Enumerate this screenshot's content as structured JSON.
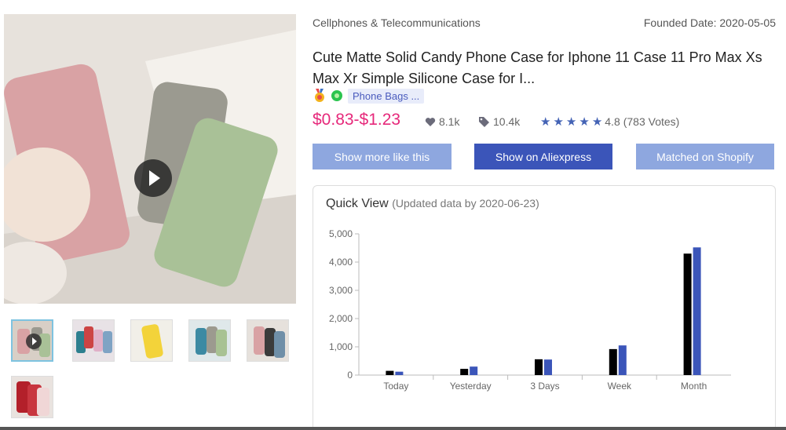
{
  "product": {
    "category": "Cellphones & Telecommunications",
    "founded": "Founded Date: 2020-05-05",
    "title": "Cute Matte Solid Candy Phone Case for Iphone 11 Case 11 Pro Max Xs Max Xr Simple Silicone Case for I...",
    "tag": "Phone Bags ...",
    "price": "$0.83-$1.23",
    "likes": "8.1k",
    "orders": "10.4k",
    "rating": "4.8",
    "votes": "(783 Votes)",
    "stars": 5
  },
  "buttons": {
    "more": "Show more like this",
    "aliexpress": "Show on Aliexpress",
    "shopify": "Matched on Shopify"
  },
  "quick_view": {
    "title": "Quick View",
    "subtitle": "(Updated data by 2020-06-23)"
  },
  "colors": {
    "price": "#e6287a",
    "accent": "#3b55b9",
    "accent_light": "#8ea7df",
    "series_a": "#000000",
    "series_b": "#3b55b9"
  },
  "icons": [
    "play-icon",
    "medal-icon",
    "leaf-icon",
    "heart-icon",
    "tag-icon",
    "star-icon"
  ],
  "chart_data": {
    "type": "bar",
    "categories": [
      "Today",
      "Yesterday",
      "3 Days",
      "Week",
      "Month"
    ],
    "series": [
      {
        "values": [
          150,
          220,
          560,
          920,
          4300
        ]
      },
      {
        "values": [
          120,
          300,
          550,
          1050,
          4520
        ]
      }
    ],
    "ylim": [
      0,
      5000
    ],
    "yticks": [
      "0",
      "1,000",
      "2,000",
      "3,000",
      "4,000",
      "5,000"
    ],
    "grid": false
  }
}
